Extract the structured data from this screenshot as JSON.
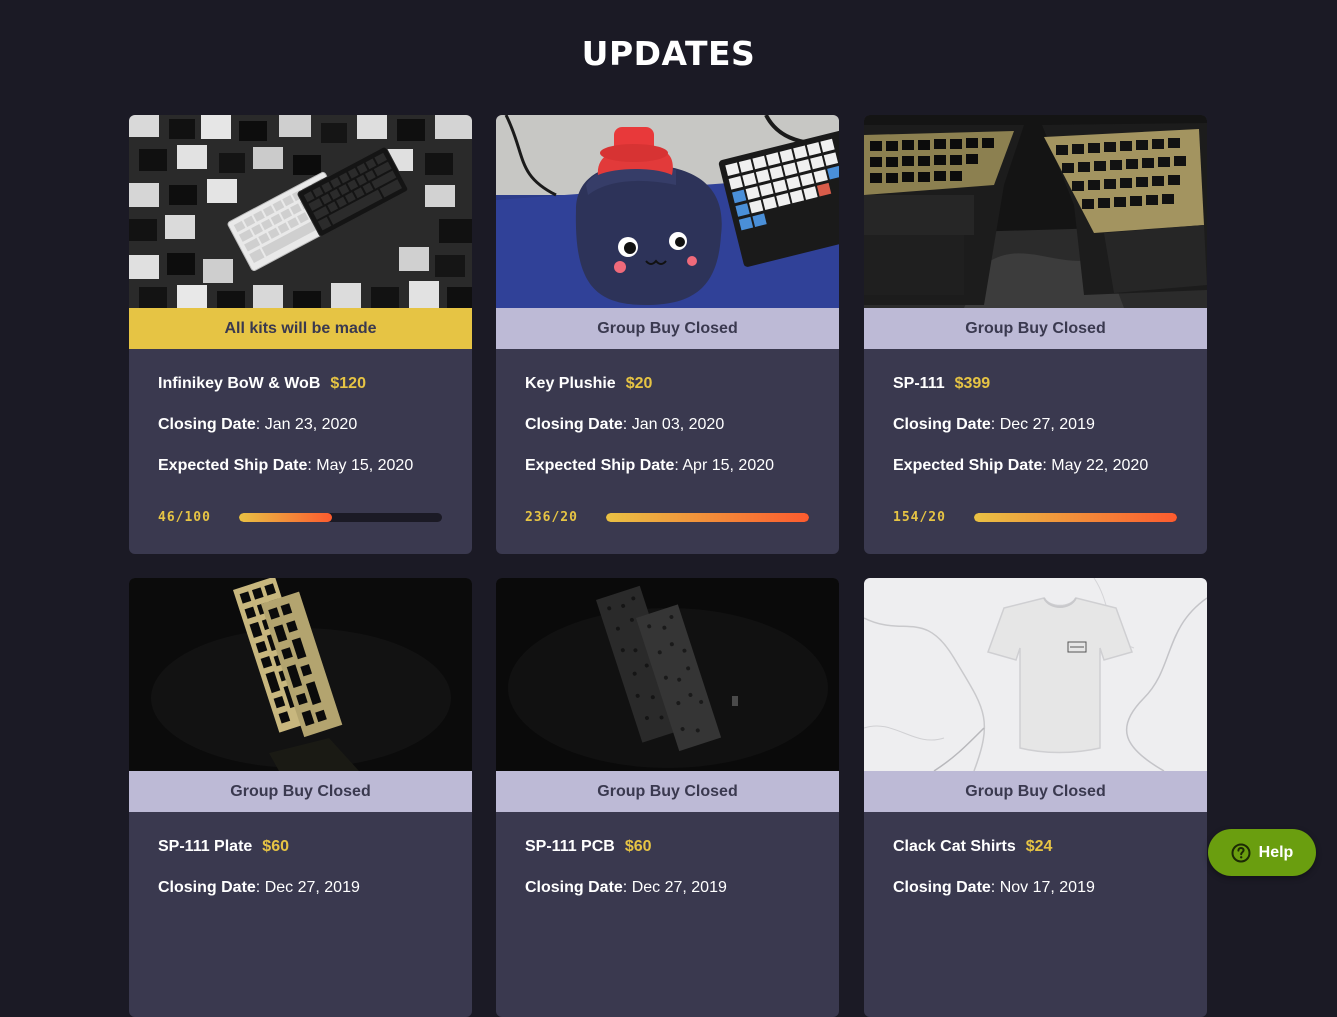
{
  "page": {
    "title": "UPDATES"
  },
  "colors": {
    "background": "#1b1a25",
    "card": "#3a394f",
    "accent_yellow": "#e6c444",
    "banner_closed": "#bdbad6",
    "progress_gradient_start": "#e9c144",
    "progress_gradient_end": "#fc5b2f",
    "help_button": "#6a9e0f"
  },
  "cards": [
    {
      "image": "white-and-black-keyboards-on-cube-blocks",
      "banner": "All kits will be made",
      "name": "Infinikey BoW & WoB",
      "price": "$120",
      "closing_label": "Closing Date",
      "closing_date": ": Jan 23, 2020",
      "ship_label": "Expected Ship Date",
      "ship_date": ": May 15, 2020",
      "progress_text": "46/100",
      "progress_fraction": 0.46
    },
    {
      "image": "navy-key-plushie-with-keyboard",
      "banner": "Group Buy Closed",
      "name": "Key Plushie",
      "price": "$20",
      "closing_label": "Closing Date",
      "closing_date": ": Jan 03, 2020",
      "ship_label": "Expected Ship Date",
      "ship_date": ": Apr 15, 2020",
      "progress_text": "236/20",
      "progress_fraction": 1.0
    },
    {
      "image": "black-keyboard-cases-with-brass-plates",
      "banner": "Group Buy Closed",
      "name": "SP-111",
      "price": "$399",
      "closing_label": "Closing Date",
      "closing_date": ": Dec 27, 2019",
      "ship_label": "Expected Ship Date",
      "ship_date": ": May 22, 2020",
      "progress_text": "154/20",
      "progress_fraction": 1.0
    },
    {
      "image": "brass-keyboard-plates-on-black",
      "banner": "Group Buy Closed",
      "name": "SP-111 Plate",
      "price": "$60",
      "closing_label": "Closing Date",
      "closing_date": ": Dec 27, 2019"
    },
    {
      "image": "black-pcb-boards-on-black",
      "banner": "Group Buy Closed",
      "name": "SP-111 PCB",
      "price": "$60",
      "closing_label": "Closing Date",
      "closing_date": ": Dec 27, 2019"
    },
    {
      "image": "white-t-shirt-on-marble",
      "banner": "Group Buy Closed",
      "name": "Clack Cat Shirts",
      "price": "$24",
      "closing_label": "Closing Date",
      "closing_date": ": Nov 17, 2019"
    }
  ],
  "help": {
    "label": "Help",
    "icon": "question-circle-icon"
  }
}
